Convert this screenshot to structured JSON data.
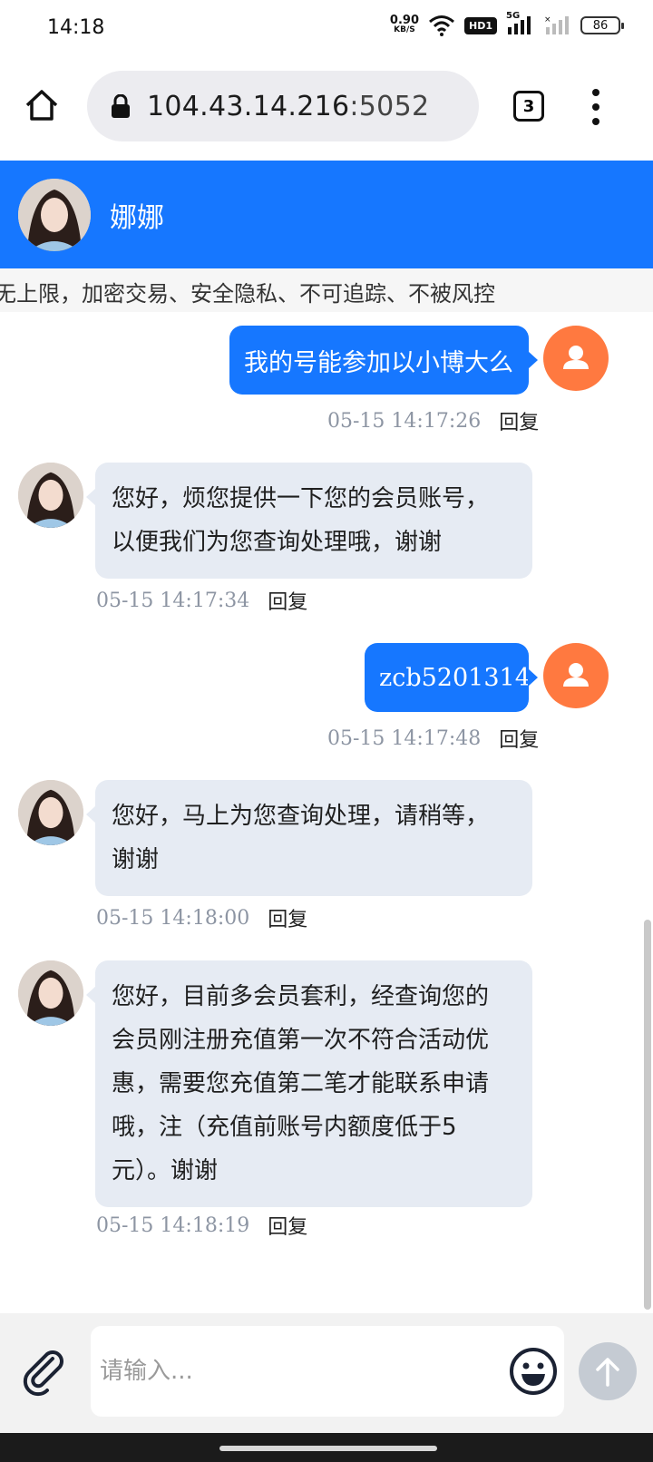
{
  "status_bar": {
    "time": "14:18",
    "net_speed": "0.90",
    "net_unit": "KB/S",
    "hd": "HD1",
    "network": "5G",
    "battery": "86"
  },
  "browser": {
    "url_host": "104.43.14.216",
    "url_port": ":5052",
    "tab_count": "3"
  },
  "chat": {
    "agent_name": "娜娜",
    "notice": "无上限，加密交易、安全隐私、不可追踪、不被风控",
    "reply_label": "回复",
    "messages": [
      {
        "side": "right",
        "text": "我的号能参加以小博大么",
        "time": "05-15 14:17:26"
      },
      {
        "side": "left",
        "lines": [
          "您好，烦您提供一下您的会员账号，",
          "以便我们为您查询处理哦，谢谢"
        ],
        "time": "05-15 14:17:34"
      },
      {
        "side": "right",
        "text": "zcb5201314",
        "time": "05-15 14:17:48"
      },
      {
        "side": "left",
        "lines": [
          "您好，马上为您查询处理，请稍等，",
          "谢谢"
        ],
        "time": "05-15 14:18:00"
      },
      {
        "side": "left",
        "lines": [
          "您好，目前多会员套利，经查询您的",
          "会员刚注册充值第一次不符合活动优",
          "惠，需要您充值第二笔才能联系申请",
          "哦，注（充值前账号内额度低于5",
          "元）。谢谢"
        ],
        "time": "05-15 14:18:19"
      }
    ],
    "input_placeholder": "请输入..."
  },
  "colors": {
    "brand": "#1677ff",
    "user_avatar": "#ff7940",
    "agent_bubble": "#e6ebf3"
  }
}
